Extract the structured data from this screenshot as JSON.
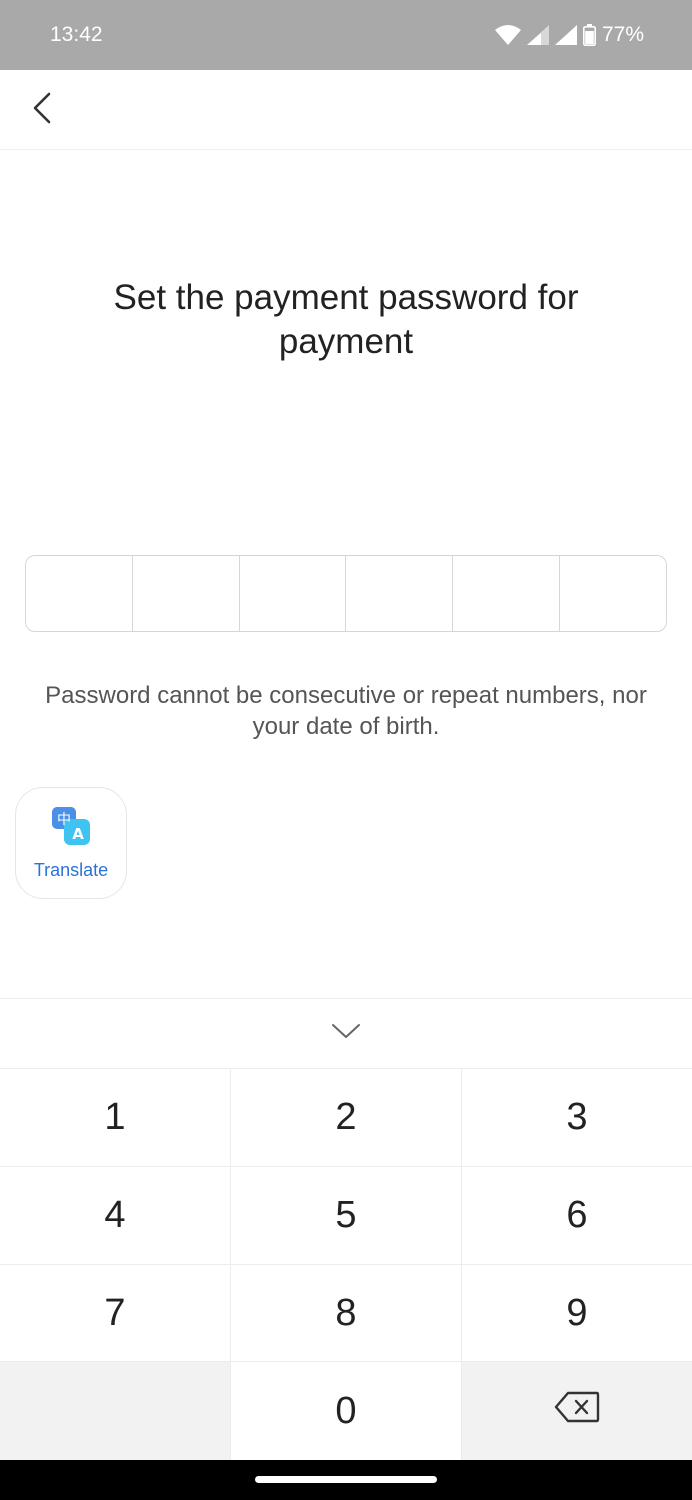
{
  "status": {
    "time": "13:42",
    "battery": "77%"
  },
  "page": {
    "title": "Set the payment password for payment",
    "hint": "Password cannot be consecutive or repeat numbers, nor your date of birth."
  },
  "pin": {
    "digits": [
      "",
      "",
      "",
      "",
      "",
      ""
    ]
  },
  "translate": {
    "label": "Translate"
  },
  "keypad": {
    "keys": [
      "1",
      "2",
      "3",
      "4",
      "5",
      "6",
      "7",
      "8",
      "9",
      "0"
    ]
  },
  "colors": {
    "status_bar": "#a9a9a9",
    "accent": "#2a73d9"
  }
}
